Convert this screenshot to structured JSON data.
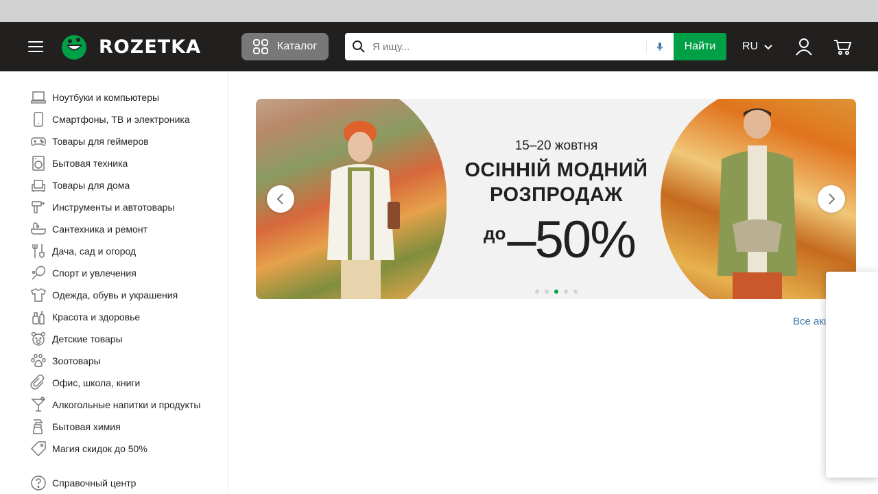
{
  "header": {
    "logo_text": "ROZETKA",
    "catalog_label": "Каталог",
    "search_placeholder": "Я ищу...",
    "search_button": "Найти",
    "language": "RU",
    "brand_color": "#00a046",
    "header_bg": "#221f1f"
  },
  "sidebar": {
    "categories": [
      {
        "label": "Ноутбуки и компьютеры",
        "icon": "laptop-icon"
      },
      {
        "label": "Смартфоны, ТВ и электроника",
        "icon": "smartphone-icon"
      },
      {
        "label": "Товары для геймеров",
        "icon": "gamepad-icon"
      },
      {
        "label": "Бытовая техника",
        "icon": "washing-machine-icon"
      },
      {
        "label": "Товары для дома",
        "icon": "armchair-icon"
      },
      {
        "label": "Инструменты и автотовары",
        "icon": "drill-icon"
      },
      {
        "label": "Сантехника и ремонт",
        "icon": "bathtub-icon"
      },
      {
        "label": "Дача, сад и огород",
        "icon": "garden-tools-icon"
      },
      {
        "label": "Спорт и увлечения",
        "icon": "racket-icon"
      },
      {
        "label": "Одежда, обувь и украшения",
        "icon": "tshirt-icon"
      },
      {
        "label": "Красота и здоровье",
        "icon": "cosmetics-icon"
      },
      {
        "label": "Детские товары",
        "icon": "teddy-bear-icon"
      },
      {
        "label": "Зоотовары",
        "icon": "paw-icon"
      },
      {
        "label": "Офис, школа, книги",
        "icon": "paperclip-icon"
      },
      {
        "label": "Алкогольные напитки и продукты",
        "icon": "cocktail-icon"
      },
      {
        "label": "Бытовая химия",
        "icon": "spray-bottle-icon"
      },
      {
        "label": "Магия скидок до 50%",
        "icon": "tag-icon"
      }
    ],
    "help_label": "Справочный центр"
  },
  "banner": {
    "date": "15–20 жовтня",
    "title_line1": "ОСІННІЙ МОДНИЙ",
    "title_line2": "РОЗПРОДАЖ",
    "discount_prefix": "до",
    "discount_value": "–50%",
    "slide_count": 5,
    "active_slide": 3
  },
  "promos_link": "Все акции"
}
